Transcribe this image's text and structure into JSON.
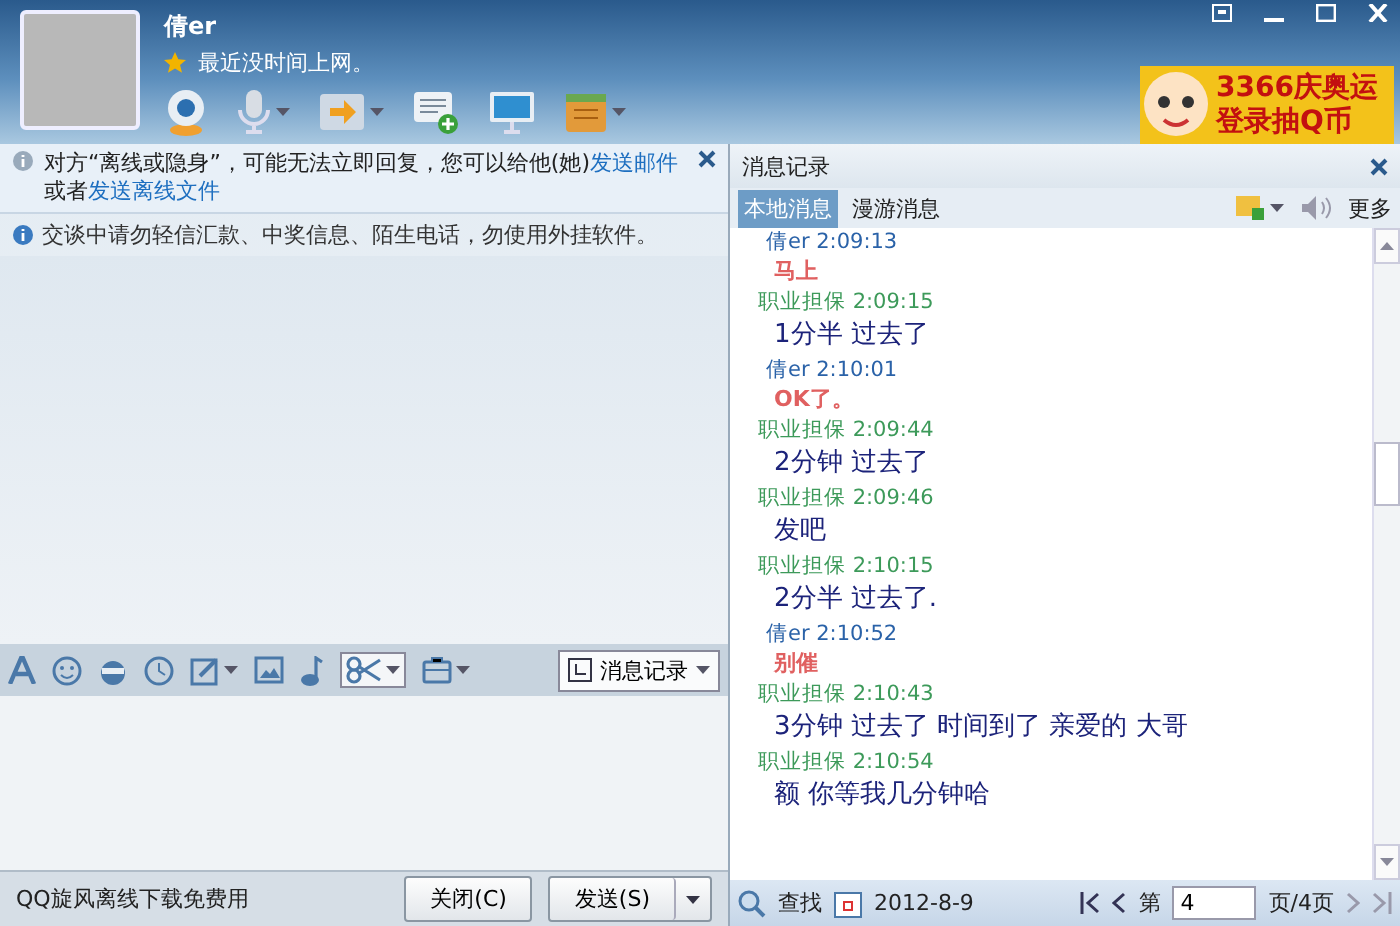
{
  "contact": {
    "name": "倩er",
    "status": "最近没时间上网。"
  },
  "ad": {
    "line_1": "3366庆奥运",
    "line_2": "登录抽Q币"
  },
  "notice": {
    "segments": [
      {
        "text": "对方“离线或隐身”，可能无法立即回复，您可以给他(她)",
        "link": false
      },
      {
        "text": "发送邮件",
        "link": true
      },
      {
        "text": "或者",
        "link": false
      },
      {
        "text": "发送离线文件",
        "link": true
      }
    ]
  },
  "tip": "交谈中请勿轻信汇款、中奖信息、陌生电话，勿使用外挂软件。",
  "history_button": "消息记录",
  "footer": {
    "promo": "QQ旋风离线下载免费用",
    "close": "关闭(C)",
    "send": "发送(S)"
  },
  "history": {
    "title": "消息记录",
    "tabs": [
      {
        "label": "本地消息",
        "selected": true
      },
      {
        "label": "漫游消息",
        "selected": false
      }
    ],
    "more": "更多",
    "messages": [
      {
        "kind": "friend",
        "sender": "倩er",
        "time": "2:09:13",
        "text": "马上"
      },
      {
        "kind": "self",
        "sender": "职业担保",
        "time": "2:09:15",
        "text": "1分半 过去了"
      },
      {
        "kind": "friend",
        "sender": "倩er",
        "time": "2:10:01",
        "text": "OK了。"
      },
      {
        "kind": "self",
        "sender": "职业担保",
        "time": "2:09:44",
        "text": "2分钟 过去了"
      },
      {
        "kind": "self",
        "sender": "职业担保",
        "time": "2:09:46",
        "text": "发吧"
      },
      {
        "kind": "self",
        "sender": "职业担保",
        "time": "2:10:15",
        "text": "2分半 过去了."
      },
      {
        "kind": "friend",
        "sender": "倩er",
        "time": "2:10:52",
        "text": "别催"
      },
      {
        "kind": "self",
        "sender": "职业担保",
        "time": "2:10:43",
        "text": "3分钟 过去了  时间到了  亲爱的 大哥"
      },
      {
        "kind": "self",
        "sender": "职业担保",
        "time": "2:10:54",
        "text": "额 你等我几分钟哈"
      }
    ],
    "find": "查找",
    "date": "2012-8-9",
    "page_prefix": "第",
    "page": "4",
    "page_suffix": "页/4页"
  }
}
